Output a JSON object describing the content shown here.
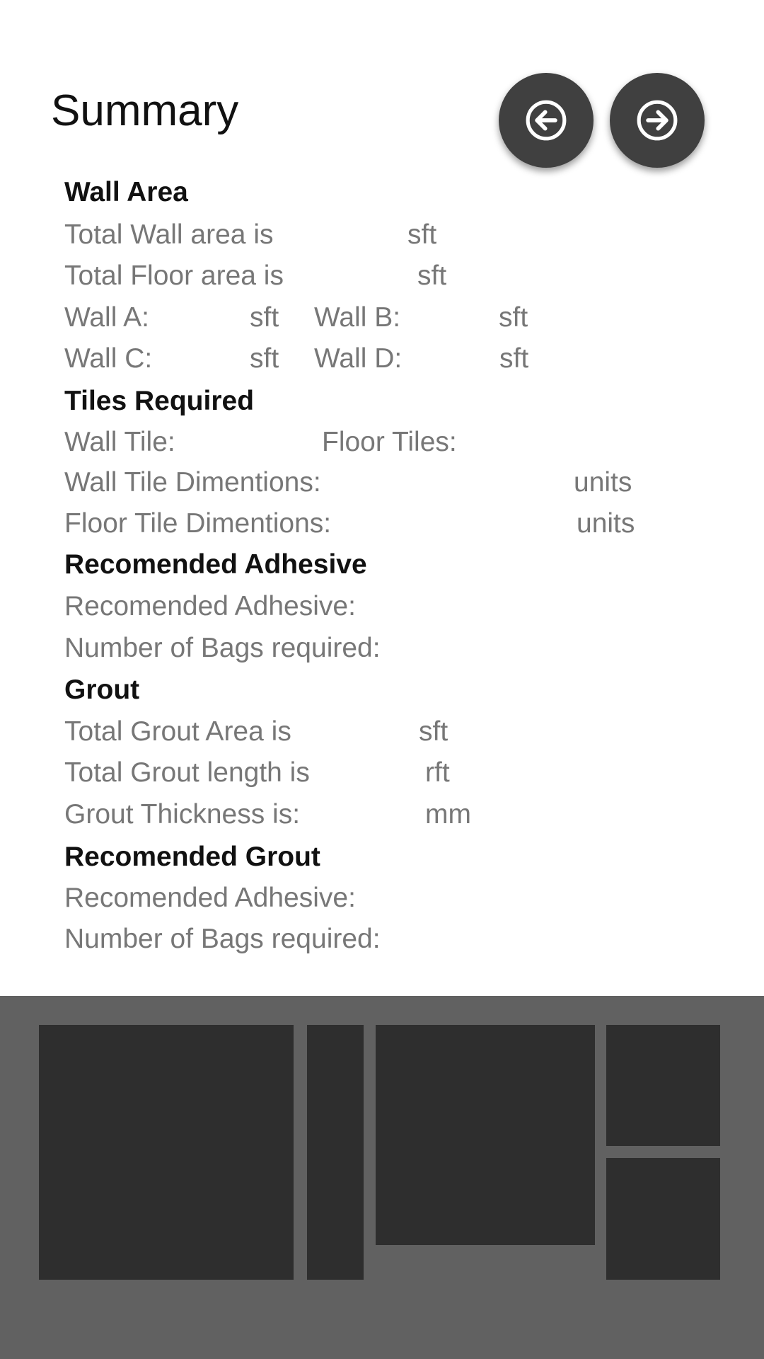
{
  "header": {
    "title": "Summary",
    "back_icon": "arrow-left-circle-icon",
    "forward_icon": "arrow-right-circle-icon"
  },
  "colors": {
    "heading": "#111111",
    "body_text": "#777777",
    "fab_background": "#404040",
    "icon_color": "#ffffff",
    "bottom_panel": "#616161",
    "tile": "#2e2e2e"
  },
  "summary": {
    "wall_area": {
      "heading": "Wall Area",
      "total_wall_label": "Total Wall area is",
      "total_wall_unit": "sft",
      "total_floor_label": "Total Floor area is",
      "total_floor_unit": "sft",
      "wall_a_label": "Wall A:",
      "wall_a_unit": "sft",
      "wall_b_label": "Wall B:",
      "wall_b_unit": "sft",
      "wall_c_label": "Wall C:",
      "wall_c_unit": "sft",
      "wall_d_label": "Wall D:",
      "wall_d_unit": "sft"
    },
    "tiles_required": {
      "heading": "Tiles Required",
      "wall_tile_label": "Wall Tile:",
      "floor_tiles_label": "Floor Tiles:",
      "wall_dim_label": "Wall Tile Dimentions:",
      "wall_dim_unit": "units",
      "floor_dim_label": "Floor Tile Dimentions:",
      "floor_dim_unit": "units"
    },
    "recommended_adhesive": {
      "heading": "Recomended Adhesive",
      "adhesive_label": "Recomended Adhesive:",
      "bags_label": "Number of Bags required:"
    },
    "grout": {
      "heading": "Grout",
      "area_label": "Total Grout Area is",
      "area_unit": "sft",
      "length_label": "Total Grout length is",
      "length_unit": "rft",
      "thickness_label": "Grout Thickness is:",
      "thickness_unit": "mm"
    },
    "recommended_grout": {
      "heading": "Recomended Grout",
      "adhesive_label": "Recomended Adhesive:",
      "bags_label": "Number of Bags required:"
    }
  }
}
